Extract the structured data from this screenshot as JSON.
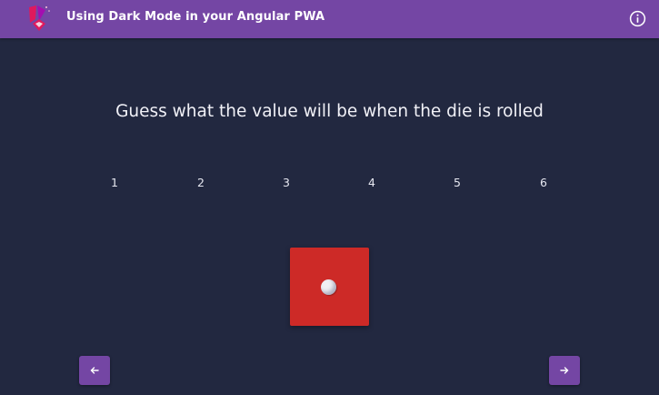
{
  "toolbar": {
    "title": "Using Dark Mode in your Angular PWA",
    "logo_icon": "angular-logo-icon",
    "info_icon": "info-icon",
    "background": "#7446a4"
  },
  "main": {
    "question": "Guess what the value will be when the die is rolled",
    "choices": [
      "1",
      "2",
      "3",
      "4",
      "5",
      "6"
    ],
    "die": {
      "face_value": 1,
      "color": "#cd2a27",
      "pip_color": "#f0f0f4"
    }
  },
  "navigation": {
    "back_icon": "arrow-left-icon",
    "next_icon": "arrow-right-icon"
  },
  "colors": {
    "page_background": "#222840",
    "accent": "#7446a4"
  }
}
